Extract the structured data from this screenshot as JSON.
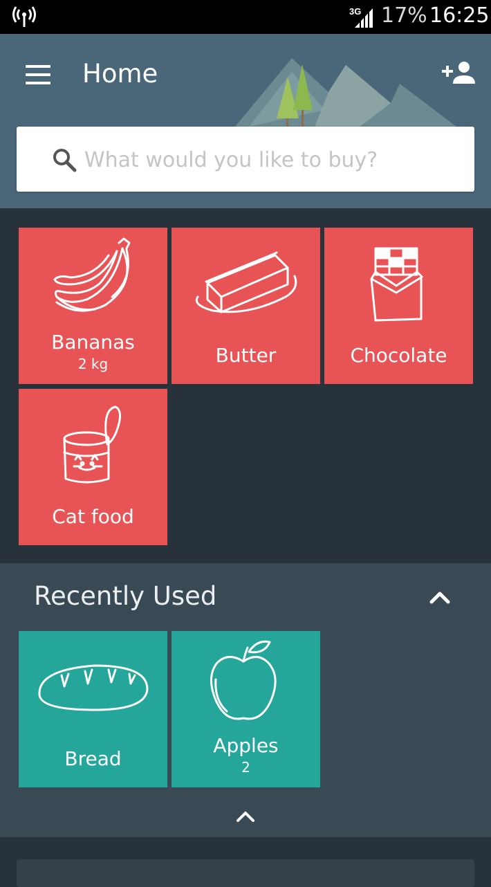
{
  "status_bar": {
    "network": "3G",
    "battery": "17%",
    "time": "16:25"
  },
  "header": {
    "title": "Home"
  },
  "search": {
    "placeholder": "What would you like to buy?"
  },
  "shopping_list": [
    {
      "name": "Bananas",
      "quantity": "2 kg",
      "icon": "banana-icon"
    },
    {
      "name": "Butter",
      "quantity": "",
      "icon": "butter-icon"
    },
    {
      "name": "Chocolate",
      "quantity": "",
      "icon": "chocolate-icon"
    },
    {
      "name": "Cat food",
      "quantity": "",
      "icon": "cat-food-can-icon"
    }
  ],
  "recently_used": {
    "title": "Recently Used",
    "items": [
      {
        "name": "Bread",
        "quantity": "",
        "icon": "bread-icon"
      },
      {
        "name": "Apples",
        "quantity": "2",
        "icon": "apple-icon"
      }
    ]
  },
  "colors": {
    "header": "#4a6779",
    "item_tile": "#e85456",
    "recent_tile": "#25a69a",
    "background": "#28323a",
    "recent_section": "#3a4a54"
  }
}
